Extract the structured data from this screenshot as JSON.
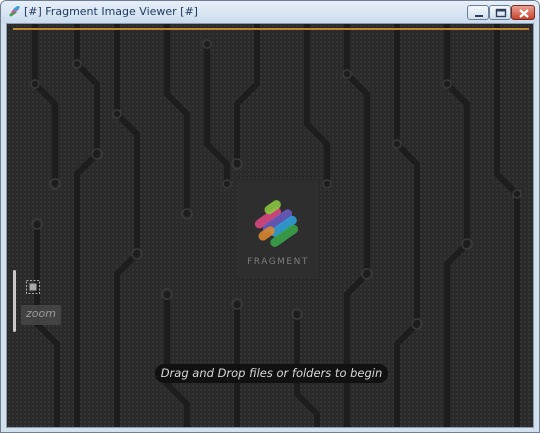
{
  "window": {
    "title": "[#] Fragment Image Viewer [#]",
    "controls": [
      "minimize",
      "maximize",
      "close"
    ]
  },
  "canvas": {
    "logo_text": "FRAGMENT",
    "hint": "Drag and Drop files or folders to begin"
  },
  "zoom": {
    "label": "zoom"
  },
  "colors": {
    "background": "#2a2a2a",
    "progress": "#b8862e",
    "hint_bg": "#111111"
  }
}
